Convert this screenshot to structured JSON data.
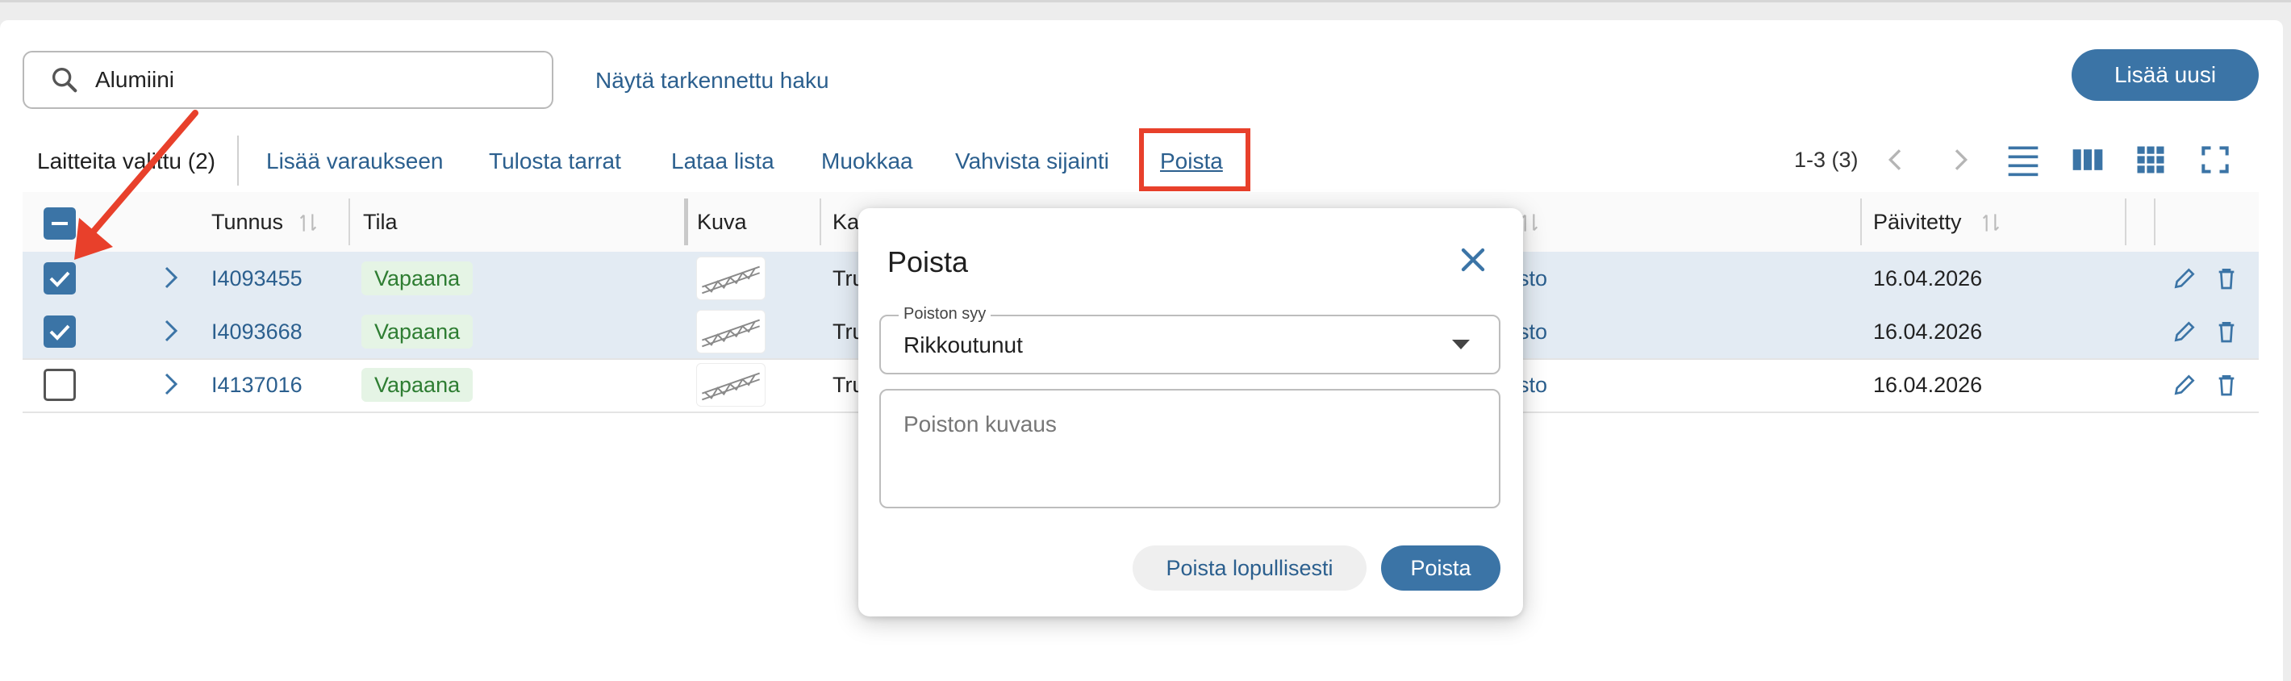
{
  "search": {
    "value": "Alumiini",
    "icon": "search-icon"
  },
  "advanced_search_label": "Näytä tarkennettu haku",
  "add_new_label": "Lisää uusi",
  "toolbar": {
    "selected_count": "Laitteita valittu (2)",
    "actions": [
      "Lisää varaukseen",
      "Tulosta tarrat",
      "Lataa lista",
      "Muokkaa",
      "Vahvista sijainti"
    ],
    "delete_label": "Poista"
  },
  "pager": {
    "range": "1-3 (3)"
  },
  "table": {
    "headers": {
      "id": "Tunnus",
      "status": "Tila",
      "image": "Kuva",
      "category": "Ka",
      "updated": "Päivitetty"
    },
    "rows": [
      {
        "id": "I4093455",
        "status": "Vapaana",
        "category": "Tru",
        "location": "sto",
        "updated": "16.04.2026",
        "selected": true
      },
      {
        "id": "I4093668",
        "status": "Vapaana",
        "category": "Tru",
        "location": "sto",
        "updated": "16.04.2026",
        "selected": true
      },
      {
        "id": "I4137016",
        "status": "Vapaana",
        "category": "Tru",
        "location": "sto",
        "updated": "16.04.2026",
        "selected": false
      }
    ]
  },
  "dialog": {
    "title": "Poista",
    "reason_label": "Poiston syy",
    "reason_value": "Rikkoutunut",
    "description_placeholder": "Poiston kuvaus",
    "permanent_delete_label": "Poista lopullisesti",
    "delete_label": "Poista"
  },
  "colors": {
    "primary": "#3b74a6",
    "link": "#2b5f8e",
    "annotation_red": "#e8402b",
    "status_bg": "#e5f4e5",
    "status_text": "#2e7d32"
  }
}
